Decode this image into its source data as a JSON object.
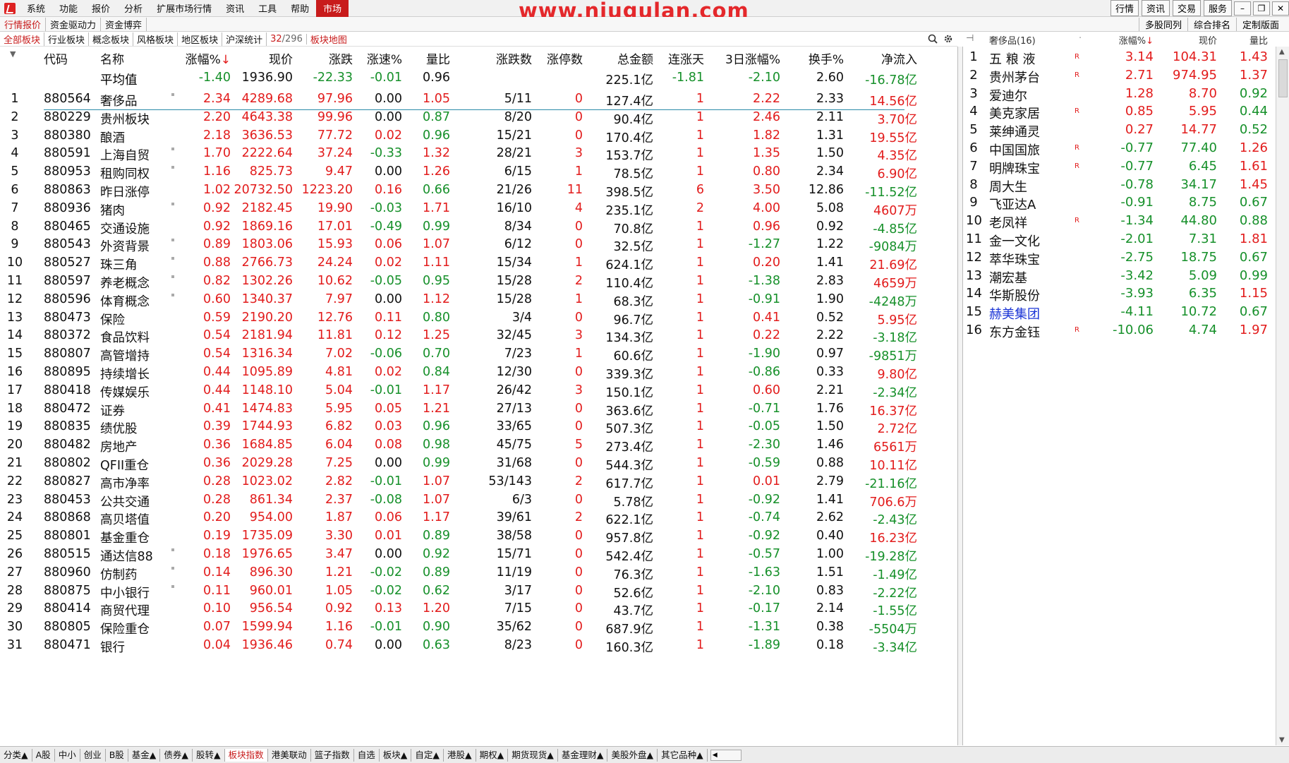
{
  "menu": {
    "items": [
      "系统",
      "功能",
      "报价",
      "分析",
      "扩展市场行情",
      "资讯",
      "工具",
      "帮助"
    ],
    "active": "市场",
    "watermark": "www.niugulan.com",
    "right_buttons": [
      "行情",
      "资讯",
      "交易",
      "服务"
    ]
  },
  "tabs2": {
    "items": [
      "行情报价",
      "资金驱动力",
      "资金博弈"
    ],
    "right": [
      "多股同列",
      "综合排名",
      "定制版面"
    ]
  },
  "tabs3": {
    "items": [
      "全部板块",
      "行业板块",
      "概念板块",
      "风格板块",
      "地区板块",
      "沪深统计"
    ],
    "count_a": "32",
    "count_sep": "/",
    "count_b": "296",
    "map": "板块地图"
  },
  "table": {
    "headers": [
      "代码",
      "名称",
      "涨幅%",
      "现价",
      "涨跌",
      "涨速%",
      "量比",
      "涨跌数",
      "涨停数",
      "总金额",
      "连涨天",
      "3日涨幅%",
      "换手%",
      "净流入"
    ],
    "sort_arrow": "↓",
    "avg": {
      "name": "平均值",
      "chg": "-1.40",
      "price": "1936.90",
      "diff": "-22.33",
      "speed": "-0.01",
      "vr": "0.96",
      "amount": "225.1亿",
      "days": "-1.81",
      "d3": "-2.10",
      "turn": "2.60",
      "flow": "-16.78亿"
    },
    "rows": [
      {
        "n": "1",
        "code": "880564",
        "name": "奢侈品",
        "dot": true,
        "chg": "2.34",
        "price": "4289.68",
        "diff": "97.96",
        "speed": "0.00",
        "vr": "1.05",
        "ud": "5/11",
        "lim": "0",
        "amount": "127.4亿",
        "days": "1",
        "d3": "2.22",
        "turn": "2.33",
        "flow": "14.56亿"
      },
      {
        "n": "2",
        "code": "880229",
        "name": "贵州板块",
        "dot": false,
        "chg": "2.20",
        "price": "4643.38",
        "diff": "99.96",
        "speed": "0.00",
        "vr": "0.87",
        "ud": "8/20",
        "lim": "0",
        "amount": "90.4亿",
        "days": "1",
        "d3": "2.46",
        "turn": "2.11",
        "flow": "3.70亿"
      },
      {
        "n": "3",
        "code": "880380",
        "name": "酿酒",
        "dot": false,
        "chg": "2.18",
        "price": "3636.53",
        "diff": "77.72",
        "speed": "0.02",
        "vr": "0.96",
        "ud": "15/21",
        "lim": "0",
        "amount": "170.4亿",
        "days": "1",
        "d3": "1.82",
        "turn": "1.31",
        "flow": "19.55亿"
      },
      {
        "n": "4",
        "code": "880591",
        "name": "上海自贸",
        "dot": true,
        "chg": "1.70",
        "price": "2222.64",
        "diff": "37.24",
        "speed": "-0.33",
        "vr": "1.32",
        "ud": "28/21",
        "lim": "3",
        "amount": "153.7亿",
        "days": "1",
        "d3": "1.35",
        "turn": "1.50",
        "flow": "4.35亿"
      },
      {
        "n": "5",
        "code": "880953",
        "name": "租购同权",
        "dot": true,
        "chg": "1.16",
        "price": "825.73",
        "diff": "9.47",
        "speed": "0.00",
        "vr": "1.26",
        "ud": "6/15",
        "lim": "1",
        "amount": "78.5亿",
        "days": "1",
        "d3": "0.80",
        "turn": "2.34",
        "flow": "6.90亿"
      },
      {
        "n": "6",
        "code": "880863",
        "name": "昨日涨停",
        "dot": false,
        "chg": "1.02",
        "price": "20732.50",
        "diff": "1223.20",
        "speed": "0.16",
        "vr": "0.66",
        "ud": "21/26",
        "lim": "11",
        "amount": "398.5亿",
        "days": "6",
        "d3": "3.50",
        "turn": "12.86",
        "flow": "-11.52亿"
      },
      {
        "n": "7",
        "code": "880936",
        "name": "猪肉",
        "dot": true,
        "chg": "0.92",
        "price": "2182.45",
        "diff": "19.90",
        "speed": "-0.03",
        "vr": "1.71",
        "ud": "16/10",
        "lim": "4",
        "amount": "235.1亿",
        "days": "2",
        "d3": "4.00",
        "turn": "5.08",
        "flow": "4607万"
      },
      {
        "n": "8",
        "code": "880465",
        "name": "交通设施",
        "dot": false,
        "chg": "0.92",
        "price": "1869.16",
        "diff": "17.01",
        "speed": "-0.49",
        "vr": "0.99",
        "ud": "8/34",
        "lim": "0",
        "amount": "70.8亿",
        "days": "1",
        "d3": "0.96",
        "turn": "0.92",
        "flow": "-4.85亿"
      },
      {
        "n": "9",
        "code": "880543",
        "name": "外资背景",
        "dot": true,
        "chg": "0.89",
        "price": "1803.06",
        "diff": "15.93",
        "speed": "0.06",
        "vr": "1.07",
        "ud": "6/12",
        "lim": "0",
        "amount": "32.5亿",
        "days": "1",
        "d3": "-1.27",
        "turn": "1.22",
        "flow": "-9084万"
      },
      {
        "n": "10",
        "code": "880527",
        "name": "珠三角",
        "dot": true,
        "chg": "0.88",
        "price": "2766.73",
        "diff": "24.24",
        "speed": "0.02",
        "vr": "1.11",
        "ud": "15/34",
        "lim": "1",
        "amount": "624.1亿",
        "days": "1",
        "d3": "0.20",
        "turn": "1.41",
        "flow": "21.69亿"
      },
      {
        "n": "11",
        "code": "880597",
        "name": "养老概念",
        "dot": true,
        "chg": "0.82",
        "price": "1302.26",
        "diff": "10.62",
        "speed": "-0.05",
        "vr": "0.95",
        "ud": "15/28",
        "lim": "2",
        "amount": "110.4亿",
        "days": "1",
        "d3": "-1.38",
        "turn": "2.83",
        "flow": "4659万"
      },
      {
        "n": "12",
        "code": "880596",
        "name": "体育概念",
        "dot": true,
        "chg": "0.60",
        "price": "1340.37",
        "diff": "7.97",
        "speed": "0.00",
        "vr": "1.12",
        "ud": "15/28",
        "lim": "1",
        "amount": "68.3亿",
        "days": "1",
        "d3": "-0.91",
        "turn": "1.90",
        "flow": "-4248万"
      },
      {
        "n": "13",
        "code": "880473",
        "name": "保险",
        "dot": false,
        "chg": "0.59",
        "price": "2190.20",
        "diff": "12.76",
        "speed": "0.11",
        "vr": "0.80",
        "ud": "3/4",
        "lim": "0",
        "amount": "96.7亿",
        "days": "1",
        "d3": "0.41",
        "turn": "0.52",
        "flow": "5.95亿"
      },
      {
        "n": "14",
        "code": "880372",
        "name": "食品饮料",
        "dot": false,
        "chg": "0.54",
        "price": "2181.94",
        "diff": "11.81",
        "speed": "0.12",
        "vr": "1.25",
        "ud": "32/45",
        "lim": "3",
        "amount": "134.3亿",
        "days": "1",
        "d3": "0.22",
        "turn": "2.22",
        "flow": "-3.18亿"
      },
      {
        "n": "15",
        "code": "880807",
        "name": "高管增持",
        "dot": false,
        "chg": "0.54",
        "price": "1316.34",
        "diff": "7.02",
        "speed": "-0.06",
        "vr": "0.70",
        "ud": "7/23",
        "lim": "1",
        "amount": "60.6亿",
        "days": "1",
        "d3": "-1.90",
        "turn": "0.97",
        "flow": "-9851万"
      },
      {
        "n": "16",
        "code": "880895",
        "name": "持续增长",
        "dot": false,
        "chg": "0.44",
        "price": "1095.89",
        "diff": "4.81",
        "speed": "0.02",
        "vr": "0.84",
        "ud": "12/30",
        "lim": "0",
        "amount": "339.3亿",
        "days": "1",
        "d3": "-0.86",
        "turn": "0.33",
        "flow": "9.80亿"
      },
      {
        "n": "17",
        "code": "880418",
        "name": "传媒娱乐",
        "dot": false,
        "chg": "0.44",
        "price": "1148.10",
        "diff": "5.04",
        "speed": "-0.01",
        "vr": "1.17",
        "ud": "26/42",
        "lim": "3",
        "amount": "150.1亿",
        "days": "1",
        "d3": "0.60",
        "turn": "2.21",
        "flow": "-2.34亿"
      },
      {
        "n": "18",
        "code": "880472",
        "name": "证券",
        "dot": false,
        "chg": "0.41",
        "price": "1474.83",
        "diff": "5.95",
        "speed": "0.05",
        "vr": "1.21",
        "ud": "27/13",
        "lim": "0",
        "amount": "363.6亿",
        "days": "1",
        "d3": "-0.71",
        "turn": "1.76",
        "flow": "16.37亿"
      },
      {
        "n": "19",
        "code": "880835",
        "name": "绩优股",
        "dot": false,
        "chg": "0.39",
        "price": "1744.93",
        "diff": "6.82",
        "speed": "0.03",
        "vr": "0.96",
        "ud": "33/65",
        "lim": "0",
        "amount": "507.3亿",
        "days": "1",
        "d3": "-0.05",
        "turn": "1.50",
        "flow": "2.72亿"
      },
      {
        "n": "20",
        "code": "880482",
        "name": "房地产",
        "dot": false,
        "chg": "0.36",
        "price": "1684.85",
        "diff": "6.04",
        "speed": "0.08",
        "vr": "0.98",
        "ud": "45/75",
        "lim": "5",
        "amount": "273.4亿",
        "days": "1",
        "d3": "-2.30",
        "turn": "1.46",
        "flow": "6561万"
      },
      {
        "n": "21",
        "code": "880802",
        "name": "QFII重仓",
        "dot": false,
        "chg": "0.36",
        "price": "2029.28",
        "diff": "7.25",
        "speed": "0.00",
        "vr": "0.99",
        "ud": "31/68",
        "lim": "0",
        "amount": "544.3亿",
        "days": "1",
        "d3": "-0.59",
        "turn": "0.88",
        "flow": "10.11亿"
      },
      {
        "n": "22",
        "code": "880827",
        "name": "高市净率",
        "dot": false,
        "chg": "0.28",
        "price": "1023.02",
        "diff": "2.82",
        "speed": "-0.01",
        "vr": "1.07",
        "ud": "53/143",
        "lim": "2",
        "amount": "617.7亿",
        "days": "1",
        "d3": "0.01",
        "turn": "2.79",
        "flow": "-21.16亿"
      },
      {
        "n": "23",
        "code": "880453",
        "name": "公共交通",
        "dot": false,
        "chg": "0.28",
        "price": "861.34",
        "diff": "2.37",
        "speed": "-0.08",
        "vr": "1.07",
        "ud": "6/3",
        "lim": "0",
        "amount": "5.78亿",
        "days": "1",
        "d3": "-0.92",
        "turn": "1.41",
        "flow": "706.6万"
      },
      {
        "n": "24",
        "code": "880868",
        "name": "高贝塔值",
        "dot": false,
        "chg": "0.20",
        "price": "954.00",
        "diff": "1.87",
        "speed": "0.06",
        "vr": "1.17",
        "ud": "39/61",
        "lim": "2",
        "amount": "622.1亿",
        "days": "1",
        "d3": "-0.74",
        "turn": "2.62",
        "flow": "-2.43亿"
      },
      {
        "n": "25",
        "code": "880801",
        "name": "基金重仓",
        "dot": false,
        "chg": "0.19",
        "price": "1735.09",
        "diff": "3.30",
        "speed": "0.01",
        "vr": "0.89",
        "ud": "38/58",
        "lim": "0",
        "amount": "957.8亿",
        "days": "1",
        "d3": "-0.92",
        "turn": "0.40",
        "flow": "16.23亿"
      },
      {
        "n": "26",
        "code": "880515",
        "name": "通达信88",
        "dot": true,
        "chg": "0.18",
        "price": "1976.65",
        "diff": "3.47",
        "speed": "0.00",
        "vr": "0.92",
        "ud": "15/71",
        "lim": "0",
        "amount": "542.4亿",
        "days": "1",
        "d3": "-0.57",
        "turn": "1.00",
        "flow": "-19.28亿"
      },
      {
        "n": "27",
        "code": "880960",
        "name": "仿制药",
        "dot": true,
        "chg": "0.14",
        "price": "896.30",
        "diff": "1.21",
        "speed": "-0.02",
        "vr": "0.89",
        "ud": "11/19",
        "lim": "0",
        "amount": "76.3亿",
        "days": "1",
        "d3": "-1.63",
        "turn": "1.51",
        "flow": "-1.49亿"
      },
      {
        "n": "28",
        "code": "880875",
        "name": "中小银行",
        "dot": true,
        "chg": "0.11",
        "price": "960.01",
        "diff": "1.05",
        "speed": "-0.02",
        "vr": "0.62",
        "ud": "3/17",
        "lim": "0",
        "amount": "52.6亿",
        "days": "1",
        "d3": "-2.10",
        "turn": "0.83",
        "flow": "-2.22亿"
      },
      {
        "n": "29",
        "code": "880414",
        "name": "商贸代理",
        "dot": false,
        "chg": "0.10",
        "price": "956.54",
        "diff": "0.92",
        "speed": "0.13",
        "vr": "1.20",
        "ud": "7/15",
        "lim": "0",
        "amount": "43.7亿",
        "days": "1",
        "d3": "-0.17",
        "turn": "2.14",
        "flow": "-1.55亿"
      },
      {
        "n": "30",
        "code": "880805",
        "name": "保险重仓",
        "dot": false,
        "chg": "0.07",
        "price": "1599.94",
        "diff": "1.16",
        "speed": "-0.01",
        "vr": "0.90",
        "ud": "35/62",
        "lim": "0",
        "amount": "687.9亿",
        "days": "1",
        "d3": "-1.31",
        "turn": "0.38",
        "flow": "-5504万"
      },
      {
        "n": "31",
        "code": "880471",
        "name": "银行",
        "dot": false,
        "chg": "0.04",
        "price": "1936.46",
        "diff": "0.74",
        "speed": "0.00",
        "vr": "0.63",
        "ud": "8/23",
        "lim": "0",
        "amount": "160.3亿",
        "days": "1",
        "d3": "-1.89",
        "turn": "0.18",
        "flow": "-3.34亿"
      }
    ]
  },
  "side": {
    "title": "奢侈品(16)",
    "headers": [
      "涨幅%",
      "现价",
      "量比"
    ],
    "sort_arrow": "↓",
    "r_mark": "R",
    "rows": [
      {
        "n": "1",
        "name": "五 粮 液",
        "r": true,
        "chg": "3.14",
        "price": "104.31",
        "vr": "1.43",
        "blue": false
      },
      {
        "n": "2",
        "name": "贵州茅台",
        "r": true,
        "chg": "2.71",
        "price": "974.95",
        "vr": "1.37",
        "blue": false
      },
      {
        "n": "3",
        "name": "爱迪尔",
        "r": false,
        "chg": "1.28",
        "price": "8.70",
        "vr": "0.92",
        "blue": false
      },
      {
        "n": "4",
        "name": "美克家居",
        "r": true,
        "chg": "0.85",
        "price": "5.95",
        "vr": "0.44",
        "blue": false
      },
      {
        "n": "5",
        "name": "莱绅通灵",
        "r": false,
        "chg": "0.27",
        "price": "14.77",
        "vr": "0.52",
        "blue": false
      },
      {
        "n": "6",
        "name": "中国国旅",
        "r": true,
        "chg": "-0.77",
        "price": "77.40",
        "vr": "1.26",
        "blue": false
      },
      {
        "n": "7",
        "name": "明牌珠宝",
        "r": true,
        "chg": "-0.77",
        "price": "6.45",
        "vr": "1.61",
        "blue": false
      },
      {
        "n": "8",
        "name": "周大生",
        "r": false,
        "chg": "-0.78",
        "price": "34.17",
        "vr": "1.45",
        "blue": false
      },
      {
        "n": "9",
        "name": "飞亚达A",
        "r": false,
        "chg": "-0.91",
        "price": "8.75",
        "vr": "0.67",
        "blue": false
      },
      {
        "n": "10",
        "name": "老凤祥",
        "r": true,
        "chg": "-1.34",
        "price": "44.80",
        "vr": "0.88",
        "blue": false
      },
      {
        "n": "11",
        "name": "金一文化",
        "r": false,
        "chg": "-2.01",
        "price": "7.31",
        "vr": "1.81",
        "blue": false
      },
      {
        "n": "12",
        "name": "萃华珠宝",
        "r": false,
        "chg": "-2.75",
        "price": "18.75",
        "vr": "0.67",
        "blue": false
      },
      {
        "n": "13",
        "name": "潮宏基",
        "r": false,
        "chg": "-3.42",
        "price": "5.09",
        "vr": "0.99",
        "blue": false
      },
      {
        "n": "14",
        "name": "华斯股份",
        "r": false,
        "chg": "-3.93",
        "price": "6.35",
        "vr": "1.15",
        "blue": false
      },
      {
        "n": "15",
        "name": "赫美集团",
        "r": false,
        "chg": "-4.11",
        "price": "10.72",
        "vr": "0.67",
        "blue": true
      },
      {
        "n": "16",
        "name": "东方金钰",
        "r": true,
        "chg": "-10.06",
        "price": "4.74",
        "vr": "1.97",
        "blue": false
      }
    ]
  },
  "bottom": {
    "tabs": [
      "分类▲",
      "A股",
      "中小",
      "创业",
      "B股",
      "基金▲",
      "债券▲",
      "股转▲",
      "板块指数",
      "港美联动",
      "篮子指数",
      "自选",
      "板块▲",
      "自定▲",
      "港股▲",
      "期权▲",
      "期货现货▲",
      "基金理财▲",
      "美股外盘▲",
      "其它品种▲"
    ],
    "active": "板块指数"
  }
}
